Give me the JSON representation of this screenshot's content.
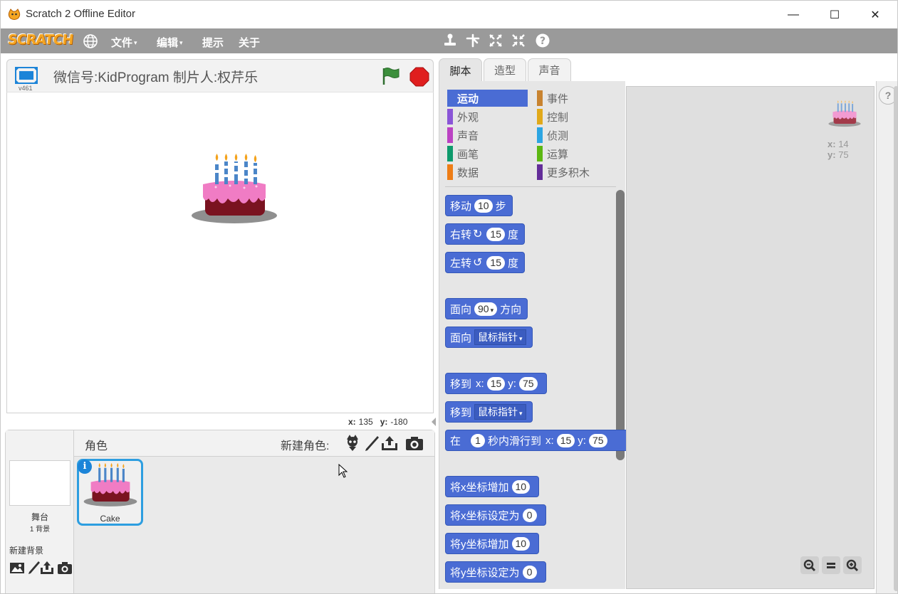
{
  "window": {
    "title": "Scratch 2 Offline Editor",
    "minimize": "—",
    "maximize": "☐",
    "close": "✕"
  },
  "menubar": {
    "logo": "SCRATCH",
    "items": [
      {
        "label": "文件",
        "has_caret": true
      },
      {
        "label": "编辑",
        "has_caret": true
      },
      {
        "label": "提示",
        "has_caret": false
      },
      {
        "label": "关于",
        "has_caret": false
      }
    ],
    "tools": [
      "duplicate-stamp-icon",
      "cut-icon",
      "grow-icon",
      "shrink-icon",
      "help-icon"
    ],
    "caret": "▾"
  },
  "stage": {
    "version": "v461",
    "project_title": "微信号:KidProgram 制片人:权芹乐",
    "mouse_x_label": "x:",
    "mouse_x": "135",
    "mouse_y_label": "y:",
    "mouse_y": "-180"
  },
  "sprites": {
    "header": "角色",
    "new_sprite_label": "新建角色:",
    "stage_name": "舞台",
    "stage_backdrops": "1 背景",
    "new_backdrop_label": "新建背景",
    "items": [
      {
        "name": "Cake",
        "selected": true
      }
    ],
    "info": "i"
  },
  "tabs": [
    {
      "label": "脚本",
      "active": true
    },
    {
      "label": "造型",
      "active": false
    },
    {
      "label": "声音",
      "active": false
    }
  ],
  "categories": [
    {
      "label": "运动",
      "color": "#4a6cd4",
      "active": true
    },
    {
      "label": "外观",
      "color": "#8a55d7",
      "active": false
    },
    {
      "label": "声音",
      "color": "#bb42c3",
      "active": false
    },
    {
      "label": "画笔",
      "color": "#0e9a6c",
      "active": false
    },
    {
      "label": "数据",
      "color": "#ee7d16",
      "active": false
    },
    {
      "label": "事件",
      "color": "#c88330",
      "active": false
    },
    {
      "label": "控制",
      "color": "#e1a91a",
      "active": false
    },
    {
      "label": "侦测",
      "color": "#2ca5e2",
      "active": false
    },
    {
      "label": "运算",
      "color": "#5cb712",
      "active": false
    },
    {
      "label": "更多积木",
      "color": "#632d99",
      "active": false
    }
  ],
  "blocks": {
    "move": {
      "a": "移动",
      "n": "10",
      "b": "步"
    },
    "turn_right": {
      "a": "右转",
      "n": "15",
      "b": "度"
    },
    "turn_left": {
      "a": "左转",
      "n": "15",
      "b": "度"
    },
    "point_dir": {
      "a": "面向",
      "n": "90",
      "b": "方向"
    },
    "point_towards": {
      "a": "面向",
      "dd": "鼠标指针"
    },
    "goto_xy": {
      "a": "移到",
      "xl": "x:",
      "x": "15",
      "yl": "y:",
      "y": "75"
    },
    "goto": {
      "a": "移到",
      "dd": "鼠标指针"
    },
    "glide": {
      "a": "在",
      "n": "1",
      "b": "秒内滑行到",
      "xl": "x:",
      "x": "15",
      "yl": "y:",
      "y": "75"
    },
    "change_x": {
      "a": "将x坐标增加",
      "n": "10"
    },
    "set_x": {
      "a": "将x坐标设定为",
      "n": "0"
    },
    "change_y": {
      "a": "将y坐标增加",
      "n": "10"
    },
    "set_y": {
      "a": "将y坐标设定为",
      "n": "0"
    }
  },
  "scripts": {
    "x_label": "x:",
    "x": "14",
    "y_label": "y:",
    "y": "75",
    "help": "?"
  },
  "colors": {
    "motion": "#4a6cd4",
    "menubar": "#9a9a9a",
    "selection": "#2d9ee0",
    "stop": "#e01e1e",
    "flag": "#3c8f3c"
  }
}
